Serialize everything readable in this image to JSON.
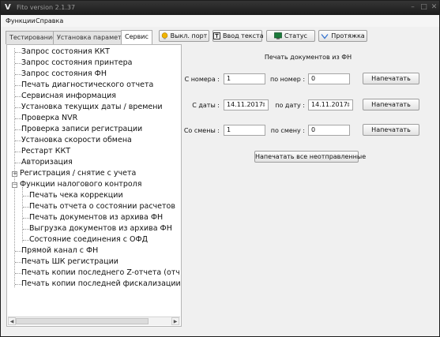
{
  "window": {
    "title": "Fito version 2.1.37"
  },
  "menu": [
    "Функции",
    "Справка"
  ],
  "tabs": [
    {
      "label": "Тестирование",
      "active": false
    },
    {
      "label": "Установка параметров",
      "active": false
    },
    {
      "label": "Сервис",
      "active": true
    }
  ],
  "toolbar": {
    "port_off": "Выкл. порт",
    "text_input": "Ввод текста",
    "status": "Статус",
    "feed": "Протяжка"
  },
  "tree": {
    "items": [
      "Запрос состояния ККТ",
      "Запрос состояния принтера",
      "Запрос состояния ФН",
      "Печать диагностического отчета",
      "Сервисная информация",
      "Установка текущих даты / времени",
      "Проверка NVR",
      "Проверка записи регистрации",
      "Установка скорости обмена",
      "Рестарт ККТ",
      "Авторизация",
      "Регистрация / снятие с учета",
      "Функции налогового контроля",
      "Печать чека коррекции",
      "Печать отчета о состоянии расчетов",
      "Печать документов из архива ФН",
      "Выгрузка документов из архива ФН",
      "Состояние соединения с ОФД",
      "Прямой канал с ФН",
      "Печать ШК регистрации",
      "Печать копии последнего Z-отчета (отчета о з",
      "Печать копии последней фискализации"
    ],
    "expander_plus": "+",
    "expander_minus": "−"
  },
  "panel": {
    "title": "Печать документов из ФН",
    "rows": [
      {
        "from_label": "С номера :",
        "from_value": "1",
        "to_label": "по номер :",
        "to_value": "0",
        "button": "Напечатать"
      },
      {
        "from_label": "С даты :",
        "from_value": "14.11.2017",
        "to_label": "по дату :",
        "to_value": "14.11.2017",
        "button": "Напечатать"
      },
      {
        "from_label": "Со смены :",
        "from_value": "1",
        "to_label": "по смену :",
        "to_value": "0",
        "button": "Напечатать"
      }
    ],
    "print_unsent": "Напечатать все неотправленные"
  },
  "icons": {
    "app": "fito-logo-icon",
    "port": "bulb-icon",
    "text": "text-box-icon",
    "status": "status-monitor-icon",
    "feed": "chevron-down-icon"
  },
  "colors": {
    "titlebar": "#262626",
    "bulb": "#f0b400",
    "status_icon": "#1a7a3a",
    "feed_icon": "#2f6fd0"
  }
}
